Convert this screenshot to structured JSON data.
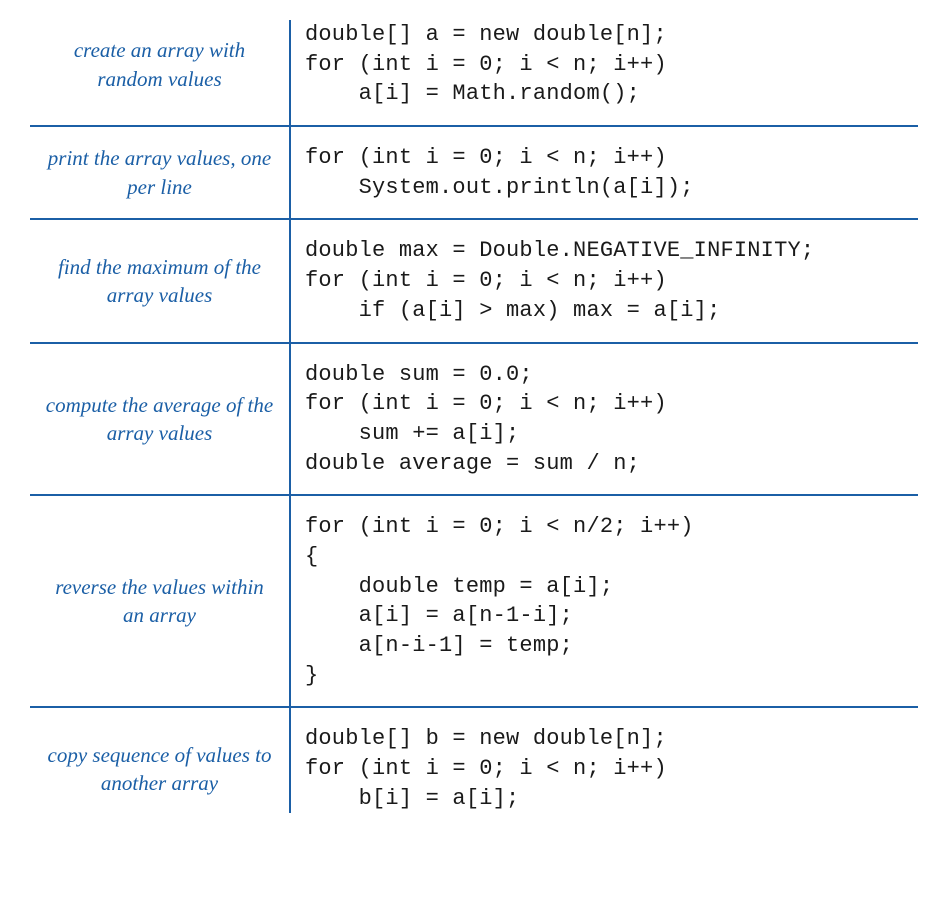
{
  "rows": [
    {
      "label": "create an array\nwith random values",
      "code": "double[] a = new double[n];\nfor (int i = 0; i < n; i++)\n    a[i] = Math.random();"
    },
    {
      "label": "print the array values,\none per line",
      "code": "for (int i = 0; i < n; i++)\n    System.out.println(a[i]);"
    },
    {
      "label": "find the maximum of\nthe array values",
      "code": "double max = Double.NEGATIVE_INFINITY;\nfor (int i = 0; i < n; i++)\n    if (a[i] > max) max = a[i];"
    },
    {
      "label": "compute the average of\nthe array values",
      "code": "double sum = 0.0;\nfor (int i = 0; i < n; i++)\n    sum += a[i];\ndouble average = sum / n;"
    },
    {
      "label": "reverse the values\nwithin an array",
      "code": "for (int i = 0; i < n/2; i++)\n{\n    double temp = a[i];\n    a[i] = a[n-1-i];\n    a[n-i-1] = temp;\n}"
    },
    {
      "label": "copy sequence of values\nto another array",
      "code": "double[] b = new double[n];\nfor (int i = 0; i < n; i++)\n    b[i] = a[i];"
    }
  ]
}
